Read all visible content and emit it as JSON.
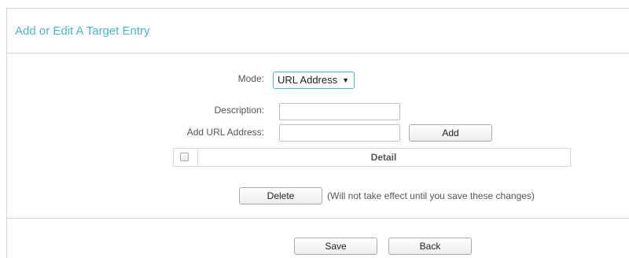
{
  "panel": {
    "title": "Add or Edit A Target Entry"
  },
  "form": {
    "mode_label": "Mode:",
    "mode_value": "URL Address",
    "description_label": "Description:",
    "description_value": "",
    "url_label": "Add URL Address:",
    "url_value": "",
    "add_button": "Add"
  },
  "table": {
    "columns": [
      "",
      "Detail"
    ],
    "rows": []
  },
  "actions": {
    "delete_button": "Delete",
    "delete_note": "(Will not take effect until you save these changes)",
    "save_button": "Save",
    "back_button": "Back"
  },
  "colors": {
    "accent": "#46b8cf",
    "border": "#d8d8d8"
  }
}
